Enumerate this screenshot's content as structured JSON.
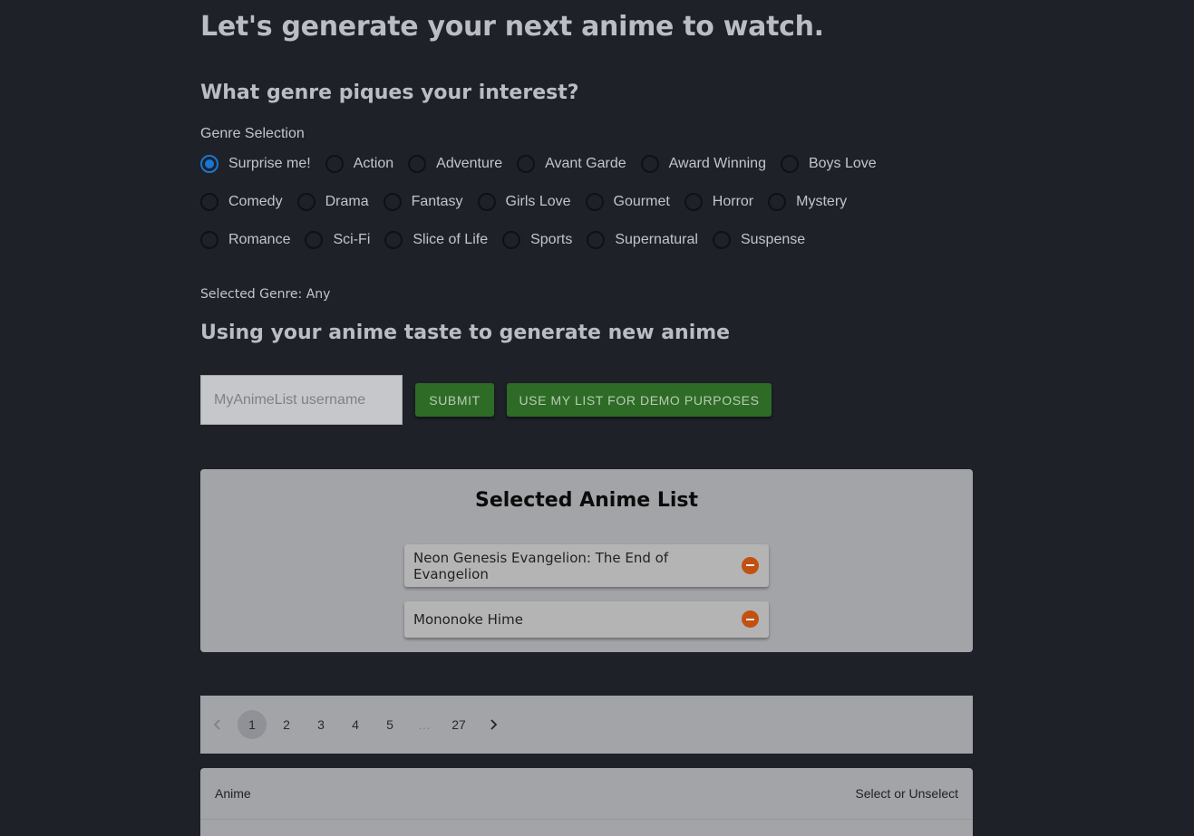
{
  "header": {
    "title": "Let's generate your next anime to watch."
  },
  "genre_section": {
    "heading": "What genre piques your interest?",
    "label": "Genre Selection",
    "options": [
      [
        "Surprise me!",
        "Action",
        "Adventure",
        "Avant Garde",
        "Award Winning",
        "Boys Love"
      ],
      [
        "Comedy",
        "Drama",
        "Fantasy",
        "Girls Love",
        "Gourmet",
        "Horror",
        "Mystery"
      ],
      [
        "Romance",
        "Sci-Fi",
        "Slice of Life",
        "Sports",
        "Supernatural",
        "Suspense"
      ]
    ],
    "selected": "Surprise me!",
    "selected_text": "Selected Genre: Any"
  },
  "taste_section": {
    "heading": "Using your anime taste to generate new anime",
    "input_placeholder": "MyAnimeList username",
    "input_value": "",
    "submit_label": "SUBMIT",
    "demo_label": "USE MY LIST FOR DEMO PURPOSES"
  },
  "selected_list": {
    "title": "Selected Anime List",
    "items": [
      "Neon Genesis Evangelion: The End of Evangelion",
      "Mononoke Hime"
    ]
  },
  "pagination": {
    "prev_icon": "chevron-left-icon",
    "pages": [
      "1",
      "2",
      "3",
      "4",
      "5",
      "…",
      "27"
    ],
    "current": "1",
    "next_icon": "chevron-right-icon"
  },
  "table": {
    "columns": [
      "Anime",
      "Select or Unselect"
    ]
  },
  "colors": {
    "background": "#1e2128",
    "panel": "#a2a4a8",
    "button_green": "#2e6b27",
    "radio_selected": "#1976d2",
    "remove_icon": "#c25011"
  }
}
